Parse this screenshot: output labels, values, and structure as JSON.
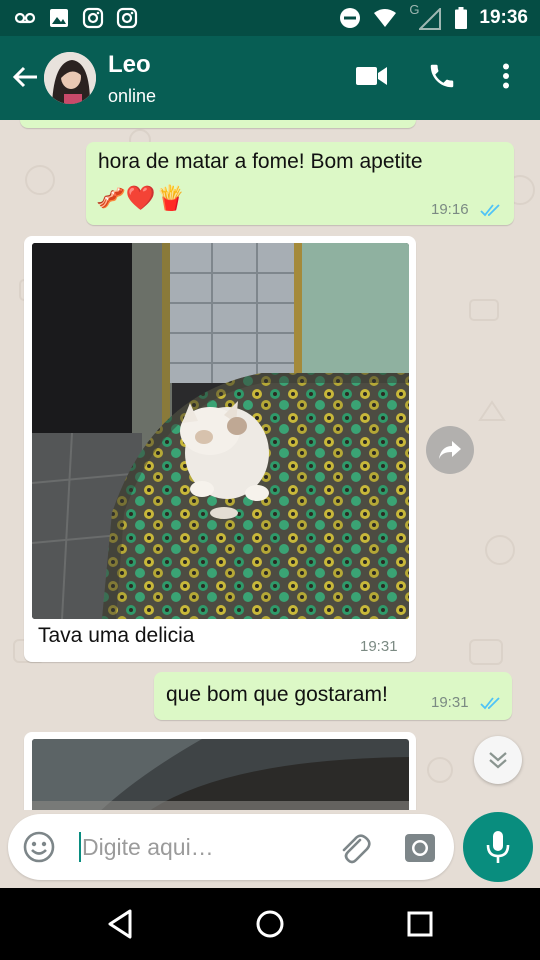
{
  "status_bar": {
    "time": "19:36",
    "network_label": "G",
    "icons_left": [
      "voicemail-icon",
      "gallery-icon",
      "instagram-icon",
      "instagram-icon"
    ],
    "icons_right": [
      "do-not-disturb-icon",
      "wifi-icon",
      "signal-icon",
      "battery-icon"
    ]
  },
  "header": {
    "contact_name": "Leo",
    "contact_status": "online",
    "actions": [
      "video-call-icon",
      "phone-icon",
      "more-vert-icon"
    ]
  },
  "messages": [
    {
      "direction": "out",
      "type": "text",
      "text": "hora de matar a fome! Bom apetite",
      "emoji": "🥓❤️🍟",
      "time": "19:16",
      "read": true
    },
    {
      "direction": "in",
      "type": "image",
      "caption": "Tava uma delicia",
      "time": "19:31"
    },
    {
      "direction": "out",
      "type": "text",
      "text": "que bom que gostaram!",
      "time": "19:31",
      "read": true
    },
    {
      "direction": "in",
      "type": "image",
      "caption": "",
      "time": ""
    }
  ],
  "composer": {
    "placeholder": "Digite aqui…"
  },
  "colors": {
    "status_bar": "#054d44",
    "header": "#075e54",
    "outgoing_bubble": "#dcf8c6",
    "incoming_bubble": "#ffffff",
    "chat_background": "#e5ddd5",
    "read_tick": "#4fc3f7",
    "mic_button": "#098d7e"
  }
}
